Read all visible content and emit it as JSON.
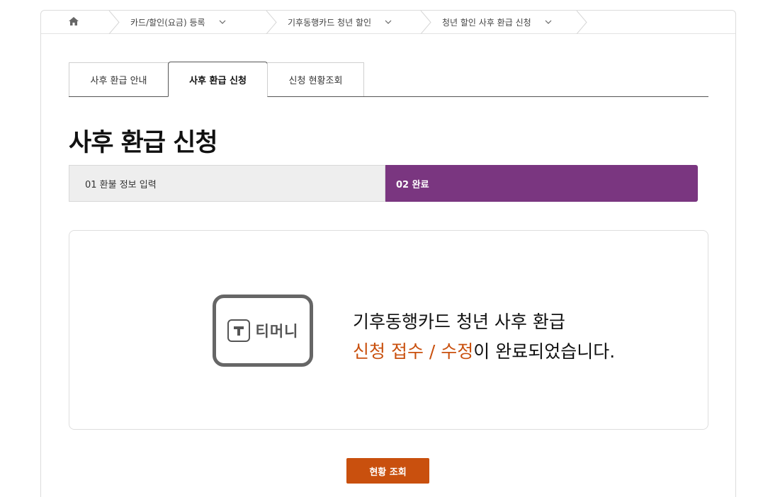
{
  "breadcrumb": {
    "items": [
      {
        "label": "카드/할인(요금) 등록"
      },
      {
        "label": "기후동행카드 청년 할인"
      },
      {
        "label": "청년 할인 사후 환급 신청"
      }
    ]
  },
  "tabs": [
    {
      "label": "사후 환급 안내"
    },
    {
      "label": "사후 환급 신청"
    },
    {
      "label": "신청 현황조회"
    }
  ],
  "page_title": "사후 환급 신청",
  "steps": [
    {
      "label": "01 환불 정보 입력"
    },
    {
      "label": "02 완료"
    }
  ],
  "completion": {
    "logo_text": "티머니",
    "line1": "기후동행카드 청년 사후 환급",
    "line2_highlight": "신청 접수 / 수정",
    "line2_rest": "이 완료되었습니다."
  },
  "status_button": "현황 조회",
  "colors": {
    "accent_purple": "#7a3680",
    "accent_orange": "#c9500e"
  }
}
